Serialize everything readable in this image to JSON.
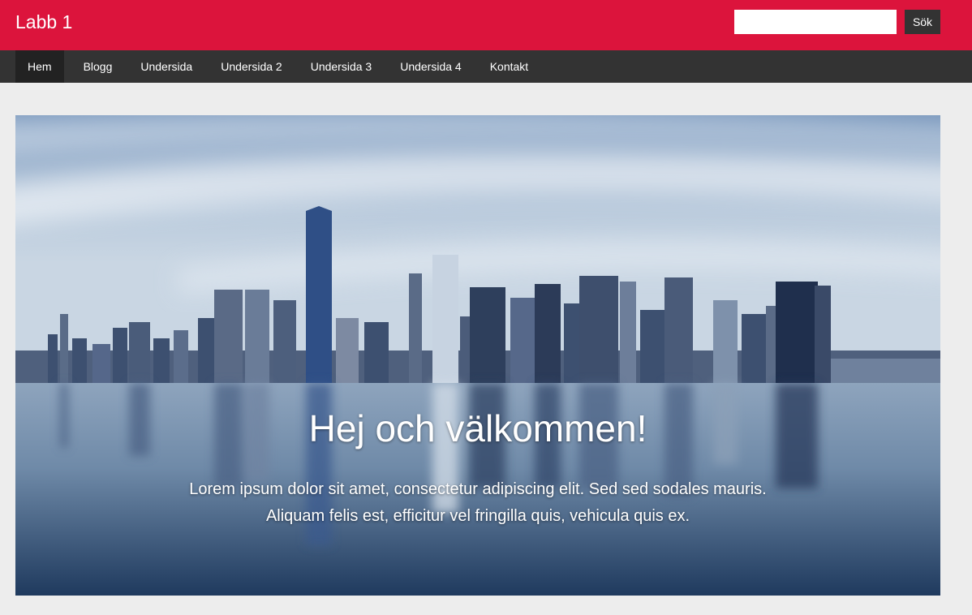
{
  "header": {
    "site_title": "Labb 1",
    "search": {
      "value": "",
      "placeholder": "",
      "button_label": "Sök"
    }
  },
  "nav": {
    "items": [
      {
        "label": "Hem",
        "active": true
      },
      {
        "label": "Blogg"
      },
      {
        "label": "Undersida"
      },
      {
        "label": "Undersida 2"
      },
      {
        "label": "Undersida 3"
      },
      {
        "label": "Undersida 4"
      },
      {
        "label": "Kontakt"
      }
    ]
  },
  "hero": {
    "title": "Hej och välkommen!",
    "text": "Lorem ipsum dolor sit amet, consectetur adipiscing elit. Sed sed sodales mauris. Aliquam felis est, efficitur vel fringilla quis, vehicula quis ex."
  },
  "colors": {
    "header_bg": "#dc143c",
    "nav_bg": "#333333",
    "nav_active_bg": "#222222",
    "page_bg": "#ededed"
  }
}
